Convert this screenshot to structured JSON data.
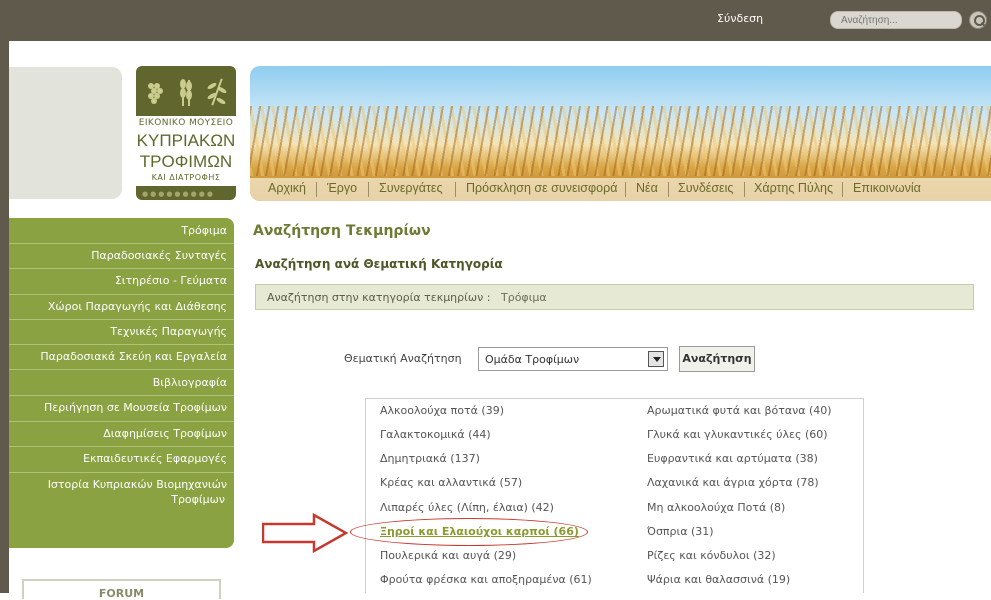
{
  "header": {
    "login_label": "Σύνδεση",
    "search_placeholder": "Αναζήτηση..."
  },
  "logo": {
    "line1": "ΕΙΚΟΝΙΚΟ ΜΟΥΣΕΙΟ",
    "line2": "ΚΥΠΡΙΑΚΩΝ",
    "line3": "ΤΡΟΦΙΜΩΝ",
    "line4": "ΚΑΙ ΔΙΑΤΡΟΦΗΣ",
    "symbol_icons": [
      "grapes-icon",
      "wheat-icon",
      "olive-branch-icon"
    ]
  },
  "nav": {
    "items": [
      "Αρχική",
      "Έργο",
      "Συνεργάτες",
      "Πρόσκληση σε συνεισφορά",
      "Νέα",
      "Συνδέσεις",
      "Χάρτης Πύλης",
      "Επικοινωνία"
    ]
  },
  "sidebar": {
    "items": [
      "Τρόφιμα",
      "Παραδοσιακές Συνταγές",
      "Σιτηρέσιο - Γεύματα",
      "Χώροι Παραγωγής και Διάθεσης",
      "Τεχνικές Παραγωγής",
      "Παραδοσιακά Σκεύη και Εργαλεία",
      "Βιβλιογραφία",
      "Περιήγηση σε Μουσεία Τροφίμων",
      "Διαφημίσεις Τροφίμων",
      "Εκπαιδευτικές Εφαρμογές",
      "Ιστορία Κυπριακών Βιομηχανιών",
      "Τροφίμων"
    ],
    "forum_label": "FORUM"
  },
  "main": {
    "title": "Αναζήτηση Τεκμηρίων",
    "subtitle": "Αναζήτηση ανά Θεματική Κατηγορία",
    "category_label": "Αναζήτηση στην κατηγορία τεκμηρίων :",
    "category_value": "Τρόφιμα",
    "theme_search_label": "Θεματική Αναζήτηση",
    "select_value": "Ομάδα Τροφίμων",
    "search_button": "Αναζήτηση",
    "categories_left": [
      "Αλκοολούχα ποτά (39)",
      "Γαλακτοκομικά (44)",
      "Δημητριακά (137)",
      "Κρέας και αλλαντικά (57)",
      "Λιπαρές ύλες (Λίπη, έλαια) (42)",
      "Ξηροί και Ελαιούχοι καρποί (66)",
      "Πουλερικά και αυγά (29)",
      "Φρούτα φρέσκα και αποξηραμένα (61)"
    ],
    "categories_right": [
      "Αρωματικά φυτά και βότανα (40)",
      "Γλυκά και γλυκαντικές ύλες (60)",
      "Ευφραντικά και αρτύματα (38)",
      "Λαχανικά και άγρια χόρτα (78)",
      "Μη αλκοολούχα Ποτά (8)",
      "Όσπρια (31)",
      "Ρίζες και κόνδυλοι (32)",
      "Ψάρια και θαλασσινά (19)"
    ],
    "highlighted_index": 5
  },
  "colors": {
    "topbar": "#5f5a4b",
    "sidebar": "#8aa242",
    "accent": "#6e7a33",
    "annotation": "#c6392e"
  }
}
